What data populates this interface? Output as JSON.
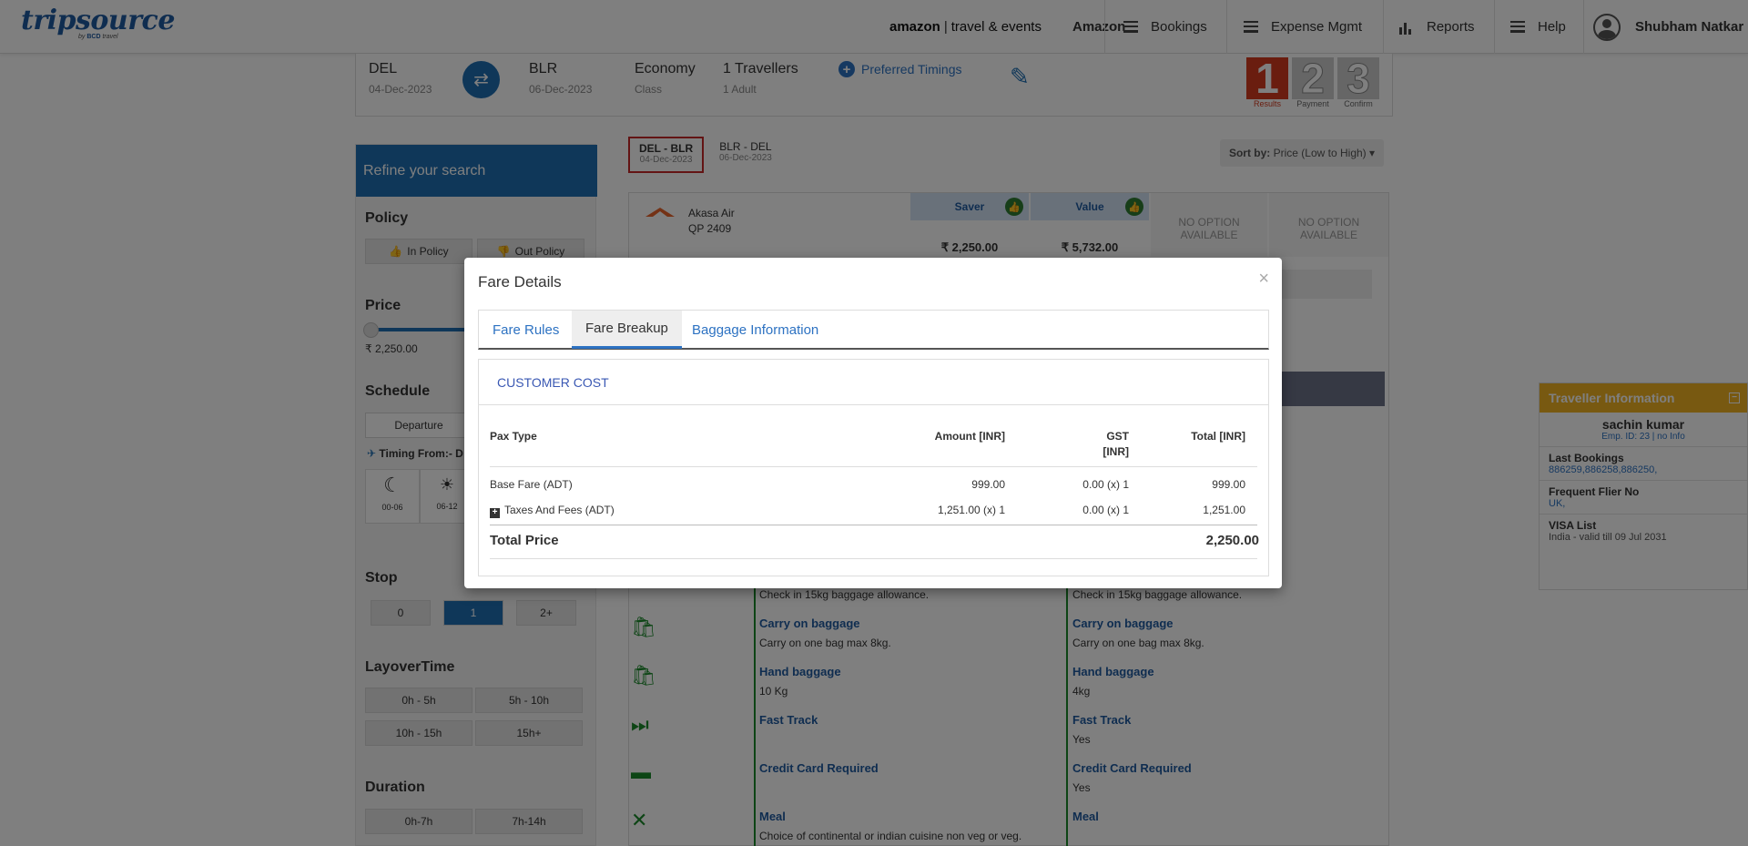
{
  "header": {
    "logo": "tripsource",
    "logo_sub_by": "by",
    "logo_sub_brand": "BCD",
    "logo_sub_tail": "travel",
    "brand_amazon": "amazon",
    "brand_te": "travel & events",
    "company": "Amazon",
    "nav": {
      "bookings": "Bookings",
      "expense": "Expense Mgmt",
      "reports": "Reports",
      "help": "Help"
    },
    "user": "Shubham Natkar"
  },
  "search": {
    "from_code": "DEL",
    "from_date": "04-Dec-2023",
    "to_code": "BLR",
    "to_date": "06-Dec-2023",
    "class": "Economy",
    "class_label": "Class",
    "travellers": "1 Travellers",
    "travellers_sub": "1 Adult",
    "preferred": "Preferred Timings",
    "steps": [
      {
        "num": "1",
        "label": "Results"
      },
      {
        "num": "2",
        "label": "Payment"
      },
      {
        "num": "3",
        "label": "Confirm"
      }
    ]
  },
  "sidebar": {
    "refine": "Refine your search",
    "policy": "Policy",
    "in_policy": "In Policy",
    "out_policy": "Out Policy",
    "price": "Price",
    "price_min": "₹ 2,250.00",
    "schedule": "Schedule",
    "departure": "Departure",
    "timing_from": "Timing From:- D",
    "time_slots": [
      "00-06",
      "06-12"
    ],
    "stop": "Stop",
    "stops": [
      "0",
      "1",
      "2+"
    ],
    "layover": "LayoverTime",
    "layovers": [
      "0h - 5h",
      "5h - 10h",
      "10h - 15h",
      "15h+"
    ],
    "duration": "Duration",
    "durations": [
      "0h-7h",
      "7h-14h"
    ]
  },
  "routes": [
    {
      "route": "DEL  -  BLR",
      "date": "04-Dec-2023"
    },
    {
      "route": "BLR  -  DEL",
      "date": "06-Dec-2023"
    }
  ],
  "sort": {
    "label": "Sort by:",
    "value": "Price (Low to High)"
  },
  "flight": {
    "airline": "Akasa Air",
    "code": "QP  2409",
    "fares": [
      {
        "name": "Saver",
        "price": "₹ 2,250.00"
      },
      {
        "name": "Value",
        "price": "₹ 5,732.00"
      }
    ],
    "no_option": "NO OPTION AVAILABLE",
    "amenities": [
      {
        "title": "",
        "left": "Check in 15kg baggage allowance.",
        "right": "Check in 15kg baggage allowance."
      },
      {
        "title": "Carry on baggage",
        "left": "Carry on one bag max 8kg.",
        "right": "Carry on one bag max 8kg."
      },
      {
        "title": "Hand baggage",
        "left": "10 Kg",
        "right": "4kg"
      },
      {
        "title": "Fast Track",
        "left": "",
        "right": "Yes"
      },
      {
        "title": "Credit Card Required",
        "left": "",
        "right": "Yes"
      },
      {
        "title": "Meal",
        "left": "Choice of continental or indian cuisine non veg or veg.",
        "right": ""
      }
    ]
  },
  "traveller": {
    "heading": "Traveller Information",
    "name": "sachin kumar",
    "emp": "Emp. ID: 23 | no Info",
    "last_bookings_label": "Last Bookings",
    "last_bookings": "886259,886258,886250,",
    "ffn_label": "Frequent Flier No",
    "ffn": "UK,",
    "visa_label": "VISA List",
    "visa": "India - valid till 09 Jul 2031"
  },
  "modal": {
    "title": "Fare Details",
    "close": "×",
    "tabs": [
      "Fare Rules",
      "Fare Breakup",
      "Baggage Information"
    ],
    "section": "CUSTOMER COST",
    "columns": {
      "pax": "Pax Type",
      "amount": "Amount [INR]",
      "gst": "GST",
      "gst2": "[INR]",
      "total": "Total [INR]"
    },
    "rows": [
      {
        "pax": "Base Fare (ADT)",
        "amount": "999.00",
        "gst": "0.00 (x) 1",
        "total": "999.00"
      },
      {
        "pax": "Taxes And Fees (ADT)",
        "amount": "1,251.00 (x) 1",
        "gst": "0.00 (x) 1",
        "total": "1,251.00"
      }
    ],
    "total_label": "Total Price",
    "total_value": "2,250.00"
  }
}
